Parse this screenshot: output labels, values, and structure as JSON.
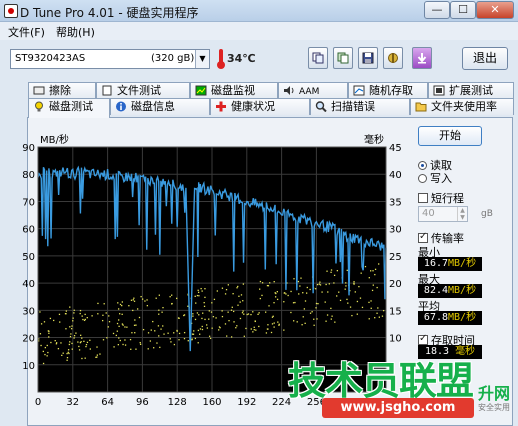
{
  "window": {
    "title": "D Tune Pro 4.01 - 硬盘实用程序",
    "min_glyph": "—",
    "max_glyph": "☐",
    "close_glyph": "✕"
  },
  "menu": [
    "文件(F)",
    "帮助(H)"
  ],
  "toolbar": {
    "drive_name": "ST9320423AS",
    "drive_capacity": "(320 gB)",
    "temperature": "34℃",
    "exit_label": "退出"
  },
  "tabs_top": [
    "擦除",
    "文件测试",
    "磁盘监视",
    "AAM",
    "随机存取",
    "扩展测试"
  ],
  "tabs_bottom": [
    "磁盘测试",
    "磁盘信息",
    "健康状况",
    "扫描错误",
    "文件夹使用率"
  ],
  "active_tab": "磁盘测试",
  "chart_data": {
    "type": "scatter",
    "left_axis_label": "MB/秒",
    "right_axis_label": "毫秒",
    "left_ticks": [
      90,
      80,
      70,
      60,
      50,
      40,
      30,
      20,
      10
    ],
    "right_ticks": [
      45,
      40,
      35,
      30,
      25,
      20,
      15,
      10,
      5
    ],
    "x_ticks": [
      "0",
      "32",
      "64",
      "96",
      "128",
      "160",
      "192",
      "224",
      "256"
    ],
    "ylim": [
      0,
      90
    ],
    "y2lim": [
      0,
      45
    ],
    "xlim": [
      0,
      320
    ],
    "grid": true,
    "transfer_rate_line": {
      "color": "#3a9be0",
      "x": [
        0,
        8,
        16,
        24,
        32,
        40,
        48,
        56,
        64,
        72,
        80,
        88,
        96,
        104,
        112,
        120,
        128,
        136,
        140,
        144,
        150,
        160,
        168,
        176,
        184,
        192,
        200,
        208,
        216,
        224,
        232,
        240,
        248,
        256,
        264,
        272,
        280,
        288,
        296,
        304,
        312,
        320
      ],
      "y": [
        80,
        81,
        80,
        81,
        80,
        81,
        80,
        80,
        80,
        79,
        79,
        79,
        78,
        78,
        77,
        77,
        76,
        75,
        15,
        76,
        75,
        74,
        73,
        72,
        71,
        70,
        69,
        68,
        67,
        66,
        65,
        64,
        63,
        62,
        61,
        60,
        58,
        57,
        56,
        55,
        54,
        53
      ]
    },
    "access_time_scatter": {
      "color": "#e6e35a",
      "x_start": 0,
      "x_end": 320,
      "y_start": 10,
      "y_end": 19
    }
  },
  "controls": {
    "start_label": "开始",
    "read_label": "读取",
    "write_label": "写入",
    "short_stroke_label": "短行程",
    "short_stroke_value": "40",
    "short_stroke_unit": "gB",
    "transfer_rate_label": "传输率",
    "min_label": "最小",
    "min_value": "16.7",
    "max_label": "最大",
    "max_value": "82.4",
    "avg_label": "平均",
    "avg_value": "67.8",
    "rate_unit": "MB/秒",
    "access_time_label": "存取时间",
    "access_value": "18.3",
    "access_unit": "毫秒"
  },
  "watermark": {
    "main": "技术员联盟",
    "right": "升网",
    "url": "www.jsgho.com",
    "small": "安全实用"
  },
  "colors": {
    "chart_bg": "#000000",
    "grid": "#3a3a3a",
    "rate_line": "#3a9be0",
    "access_dots": "#e6e35a"
  }
}
